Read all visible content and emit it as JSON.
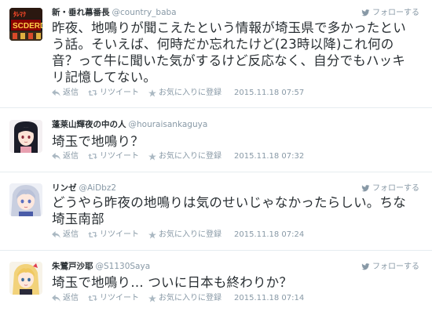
{
  "tweets": [
    {
      "name": "新・垂れ幕番長",
      "handle": "@country_baba",
      "text": "昨夜、地鳴りが聞こえたという情報が埼玉県で多かったという話。そいえば、何時だか忘れたけど(23時以降)これ何の音？って牛に聞いた気がするけど反応なく、自分でもハッキリ記憶してない。",
      "timestamp": "2015.11.18 07:57"
    },
    {
      "name": "蓬莱山輝夜の中の人",
      "handle": "@houraisankaguya",
      "text": "埼玉で地鳴り？",
      "timestamp": "2015.11.18 07:32"
    },
    {
      "name": "リンゼ",
      "handle": "@AiDbz2",
      "text": "どうやら昨夜の地鳴りは気のせいじゃなかったらしい。ちな埼玉南部",
      "timestamp": "2015.11.18 07:24"
    },
    {
      "name": "朱鷺戸沙耶",
      "handle": "@S1130Saya",
      "text": "埼玉で地鳴り… ついに日本も終わりか？",
      "timestamp": "2015.11.18 07:14"
    }
  ],
  "labels": {
    "follow": "フォローする",
    "reply": "返信",
    "retweet": "リツイート",
    "favorite": "お気に入りに登録"
  },
  "icons": {
    "follow": "follow-bird-icon",
    "reply": "reply-icon",
    "retweet": "retweet-icon",
    "favorite": "star-icon"
  },
  "colors": {
    "muted": "#8899a6",
    "text": "#292f33",
    "divider": "#e6ecf0"
  }
}
